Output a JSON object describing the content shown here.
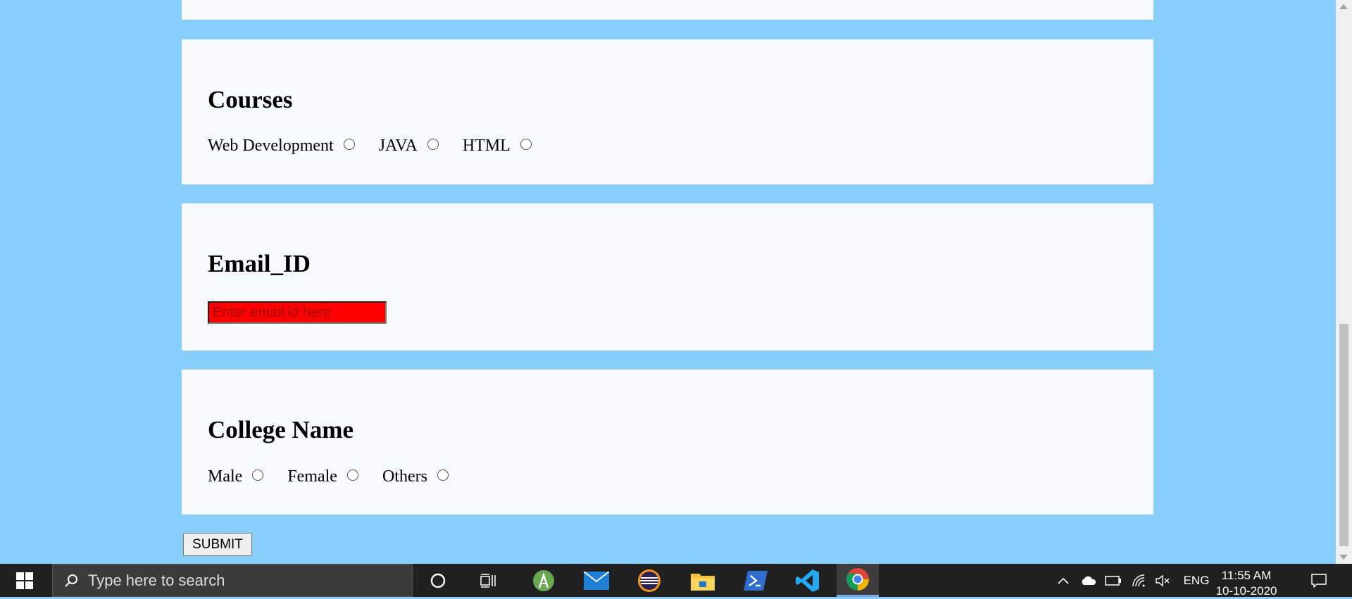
{
  "sections": {
    "courses": {
      "title": "Courses",
      "options": [
        "Web Development",
        "JAVA",
        "HTML"
      ]
    },
    "email": {
      "title": "Email_ID",
      "placeholder": "Enter email id here"
    },
    "college": {
      "title": "College Name",
      "options": [
        "Male",
        "Female",
        "Others"
      ]
    }
  },
  "submit_label": "SUBMIT",
  "taskbar": {
    "search_placeholder": "Type here to search",
    "apps": [
      "cortana-icon",
      "task-view-icon",
      "android-studio-icon",
      "mail-icon",
      "eclipse-icon",
      "file-explorer-icon",
      "powershell-icon",
      "vscode-icon",
      "chrome-icon"
    ],
    "language": "ENG",
    "time": "11:55 AM",
    "date": "10-10-2020"
  },
  "colors": {
    "background": "#87cefa",
    "card": "#f8f8ff",
    "email_field": "#ff0000"
  }
}
